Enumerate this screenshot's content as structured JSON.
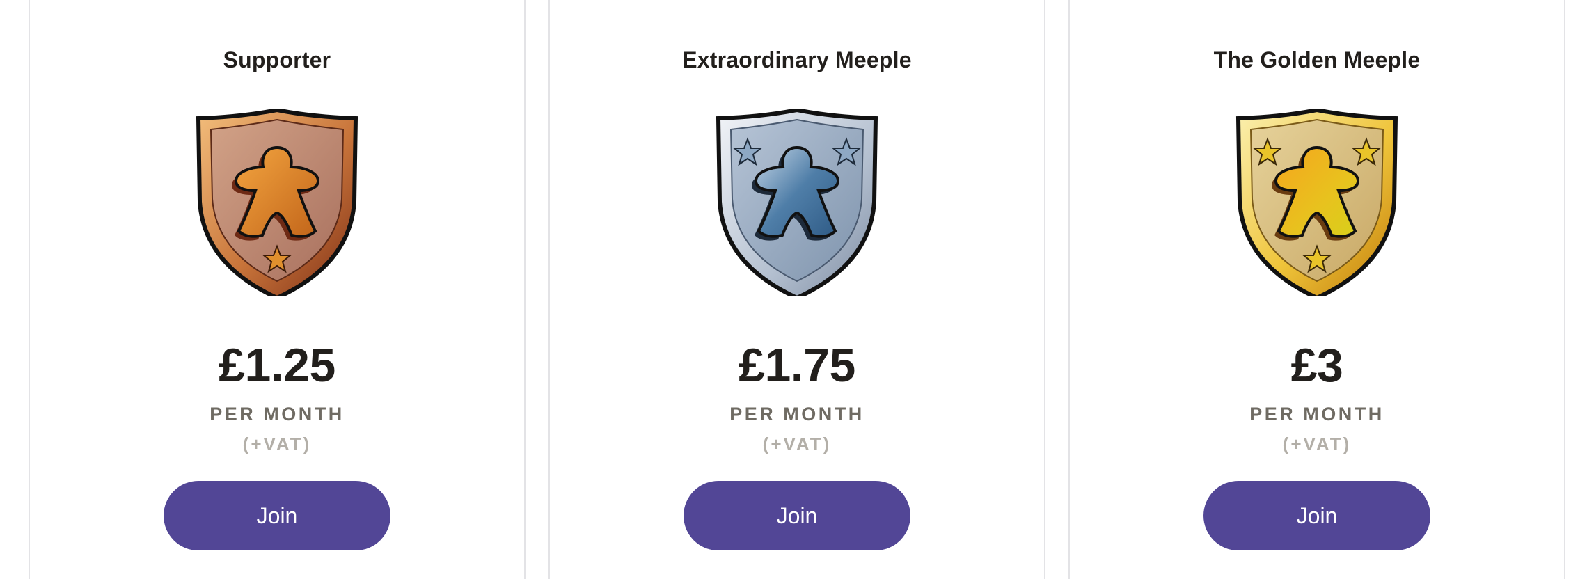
{
  "tiers": [
    {
      "name": "Supporter",
      "badge_icon": "bronze-meeple-shield-icon",
      "price": "£1.25",
      "period": "PER MONTH",
      "vat": "(+VAT)",
      "button_label": "Join",
      "colors": {
        "metal_light": "#e3a868",
        "metal_dark": "#9a4a24",
        "inner": "#b8826c",
        "meeple": "#e08a2a"
      }
    },
    {
      "name": "Extraordinary Meeple",
      "badge_icon": "silver-meeple-shield-icon",
      "price": "£1.75",
      "period": "PER MONTH",
      "vat": "(+VAT)",
      "button_label": "Join",
      "colors": {
        "metal_light": "#dfe4ec",
        "metal_dark": "#8c9bb0",
        "inner": "#97a9bf",
        "meeple": "#4c7aa5"
      }
    },
    {
      "name": "The Golden Meeple",
      "badge_icon": "gold-meeple-shield-icon",
      "price": "£3",
      "period": "PER MONTH",
      "vat": "(+VAT)",
      "button_label": "Join",
      "colors": {
        "metal_light": "#f2dc7a",
        "metal_dark": "#d89a12",
        "inner": "#d5bb7c",
        "meeple": "#e6b81c"
      }
    }
  ],
  "accent_color": "#524696"
}
